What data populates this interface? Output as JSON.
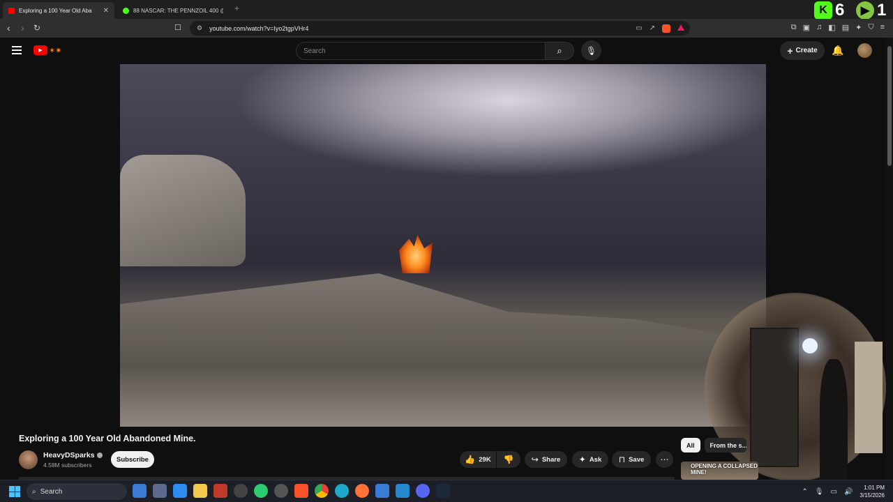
{
  "browser": {
    "tabs": [
      {
        "title": "Exploring a 100 Year Old Aba",
        "active": true,
        "favicon_color": "#ff0000"
      },
      {
        "title": "88 NASCAR: THE PENNZOIL 400 @ L",
        "active": false,
        "favicon_color": "#53fc18"
      }
    ],
    "new_tab_symbol": "+",
    "address": "youtube.com/watch?v=Iyo2tgpVHr4",
    "overlay_counters": [
      {
        "icon": "kick-icon",
        "value": "6",
        "color": "#53fc18"
      },
      {
        "icon": "rumble-icon",
        "value": "1",
        "color": "#85c742"
      }
    ]
  },
  "youtube": {
    "search_placeholder": "Search",
    "create_label": "Create",
    "video": {
      "title": "Exploring a 100 Year Old Abandoned Mine.",
      "channel": "HeavyDSparks",
      "subscribers": "4.58M subscribers",
      "subscribe_label": "Subscribe",
      "likes": "29K",
      "share_label": "Share",
      "ask_label": "Ask",
      "save_label": "Save"
    },
    "chips": [
      "All",
      "From the s..."
    ],
    "recommended_thumb_text": "OPENING A COLLAPSED MINE!"
  },
  "taskbar": {
    "search_label": "Search",
    "time": "1:01 PM",
    "date": "3/15/2026",
    "apps": [
      "widgets-icon",
      "app-icon",
      "app-icon",
      "file-explorer-icon",
      "app-icon",
      "app-icon",
      "app-icon",
      "app-icon",
      "brave-icon",
      "chrome-icon",
      "edge-icon",
      "firefox-icon",
      "app-icon",
      "vscode-icon",
      "discord-icon",
      "steam-icon"
    ]
  }
}
